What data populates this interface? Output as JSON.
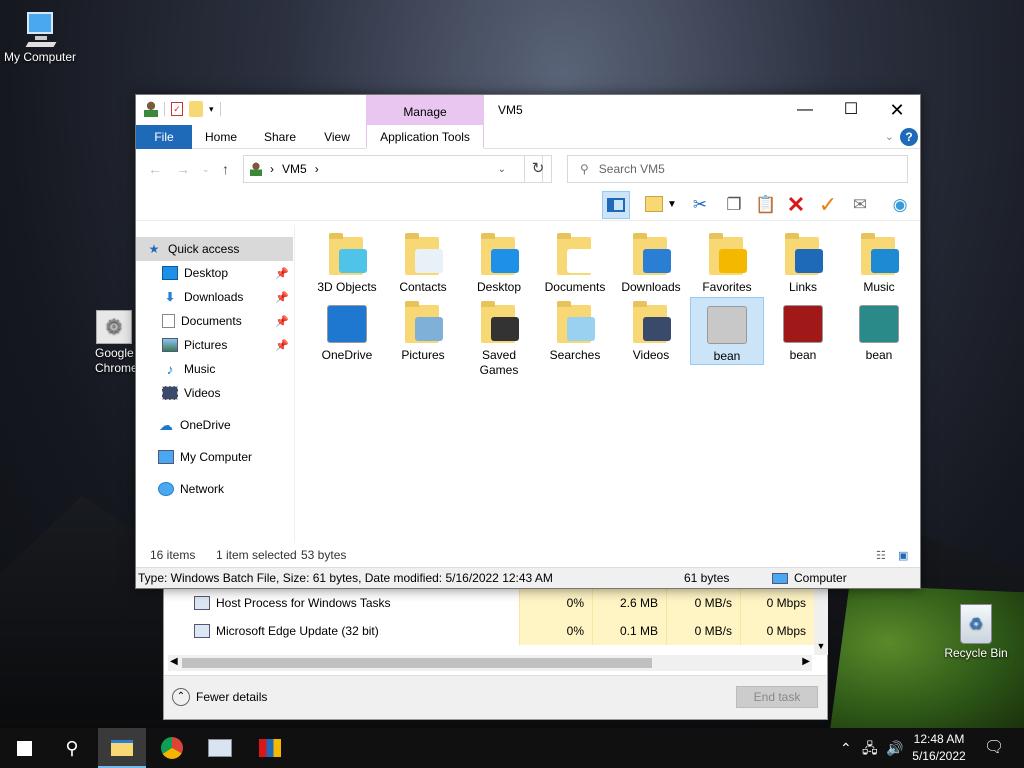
{
  "desktop": {
    "icons": [
      {
        "label": "My Computer"
      },
      {
        "label": "Google Chrome"
      },
      {
        "label": "Recycle Bin"
      }
    ]
  },
  "task_manager": {
    "rows": [
      {
        "name": "Host Process for Windows Tasks",
        "cpu": "0%",
        "memory": "2.6 MB",
        "disk": "0 MB/s",
        "network": "0 Mbps"
      },
      {
        "name": "Microsoft Edge Update (32 bit)",
        "cpu": "0%",
        "memory": "0.1 MB",
        "disk": "0 MB/s",
        "network": "0 Mbps"
      }
    ],
    "fewer_details": "Fewer details",
    "end_task": "End task"
  },
  "explorer": {
    "title": "VM5",
    "manage_tab": "Manage",
    "ribbon_tabs": {
      "file": "File",
      "home": "Home",
      "share": "Share",
      "view": "View",
      "app_tools": "Application Tools"
    },
    "help": "?",
    "address": {
      "segment": "VM5",
      "sep": "›"
    },
    "search_placeholder": "Search VM5",
    "nav": [
      {
        "label": "Quick access",
        "selected": true
      },
      {
        "label": "Desktop",
        "pinned": true
      },
      {
        "label": "Downloads",
        "pinned": true
      },
      {
        "label": "Documents",
        "pinned": true
      },
      {
        "label": "Pictures",
        "pinned": true
      },
      {
        "label": "Music"
      },
      {
        "label": "Videos"
      },
      {
        "label": "OneDrive"
      },
      {
        "label": "My Computer"
      },
      {
        "label": "Network"
      }
    ],
    "files": [
      {
        "label": "3D Objects",
        "icon": "3d-objects-folder-icon",
        "overlay": "#4fc3e8"
      },
      {
        "label": "Contacts",
        "icon": "contacts-folder-icon",
        "overlay": "#e8f0f8"
      },
      {
        "label": "Desktop",
        "icon": "desktop-folder-icon",
        "overlay": "#1e90e8"
      },
      {
        "label": "Documents",
        "icon": "documents-folder-icon",
        "overlay": "#ffffff"
      },
      {
        "label": "Downloads",
        "icon": "downloads-folder-icon",
        "overlay": "#2a7fd4"
      },
      {
        "label": "Favorites",
        "icon": "favorites-folder-icon",
        "overlay": "#f5b800"
      },
      {
        "label": "Links",
        "icon": "links-folder-icon",
        "overlay": "#1f6ab8"
      },
      {
        "label": "Music",
        "icon": "music-folder-icon",
        "overlay": "#1f8ad4"
      },
      {
        "label": "OneDrive",
        "icon": "onedrive-icon",
        "overlay": "#1e78d0"
      },
      {
        "label": "Pictures",
        "icon": "pictures-folder-icon",
        "overlay": "#7fb0d8"
      },
      {
        "label": "Saved Games",
        "icon": "saved-games-folder-icon",
        "overlay": "#333333"
      },
      {
        "label": "Searches",
        "icon": "searches-folder-icon",
        "overlay": "#9ad0f0"
      },
      {
        "label": "Videos",
        "icon": "videos-folder-icon",
        "overlay": "#3a4a6a"
      },
      {
        "label": "bean",
        "icon": "batch-file-gear-icon",
        "overlay": "#c8c8c8",
        "selected": true
      },
      {
        "label": "bean",
        "icon": "bean-image-icon",
        "overlay": "#a01818"
      },
      {
        "label": "bean",
        "icon": "script-file-icon",
        "overlay": "#2a8a8a"
      }
    ],
    "status": {
      "count": "16 items",
      "selected": "1 item selected",
      "size": "53 bytes"
    },
    "details": {
      "type_info": "Type: Windows Batch File, Size: 61 bytes, Date modified: 5/16/2022 12:43 AM",
      "size": "61 bytes",
      "location": "Computer"
    }
  },
  "taskbar": {
    "clock_time": "12:48 AM",
    "clock_date": "5/16/2022"
  }
}
